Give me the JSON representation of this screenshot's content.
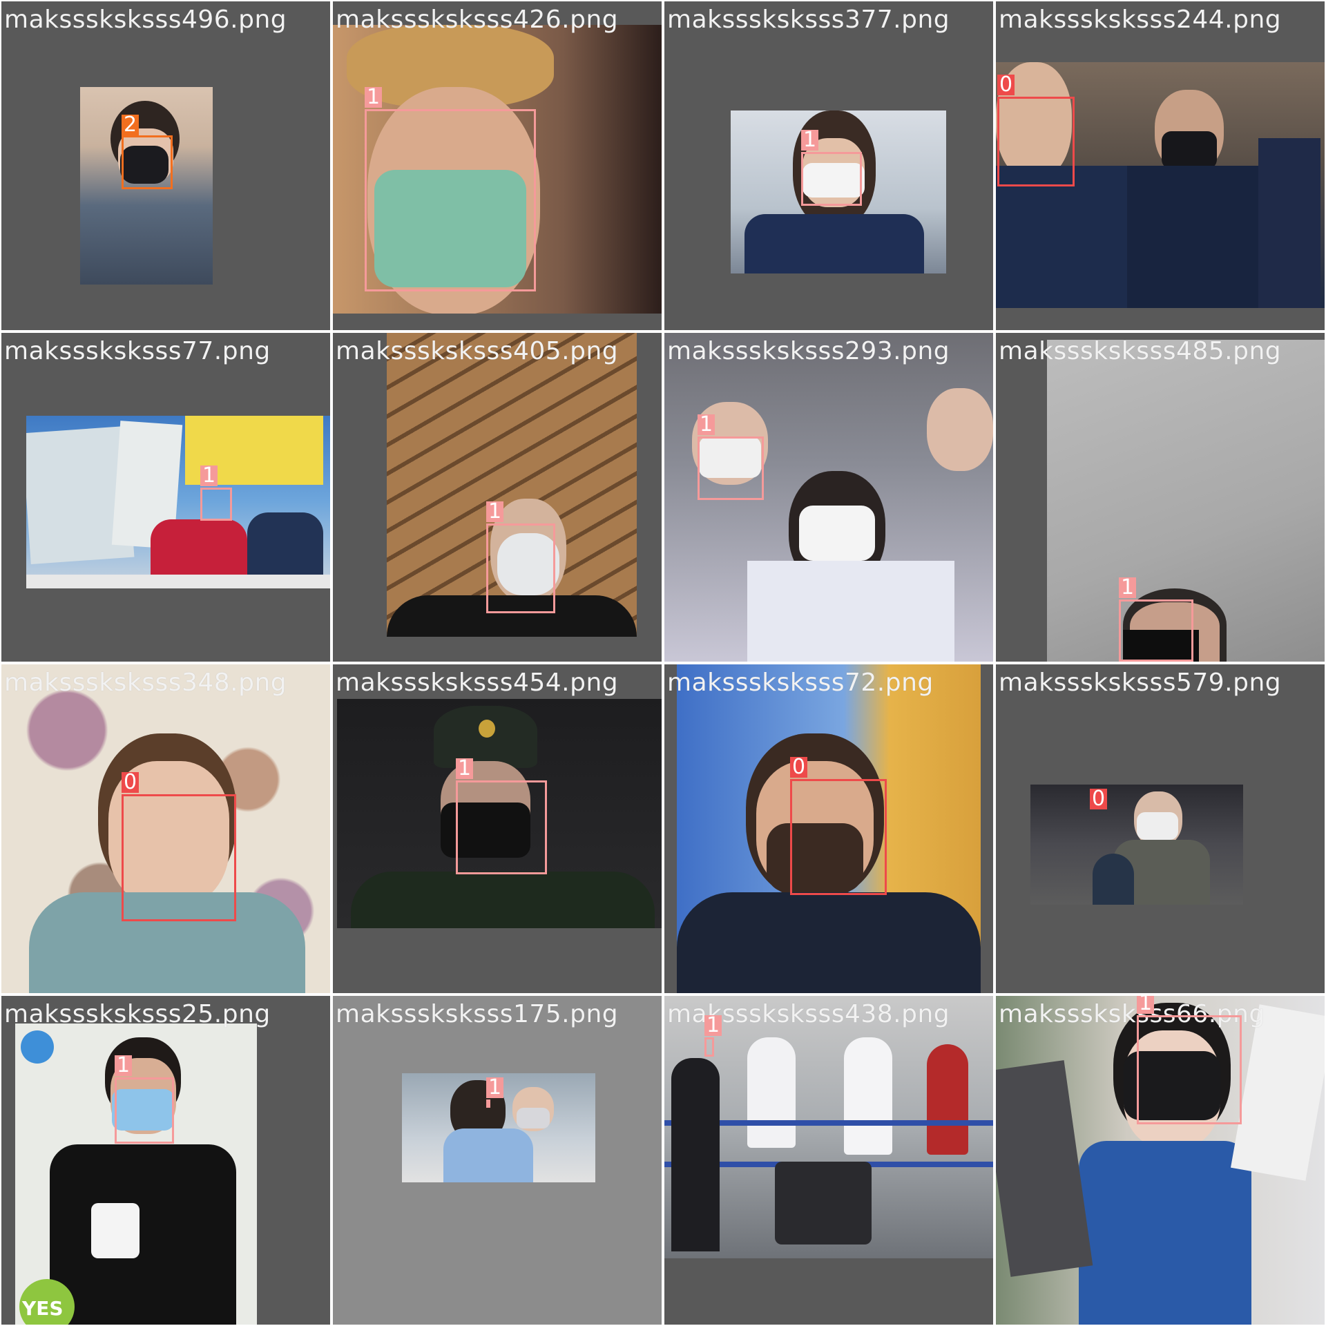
{
  "class_colors": {
    "0": "#ee4a4a",
    "1": "#f59a9a",
    "2": "#f26f1f"
  },
  "tiles": [
    {
      "file": "maksssksksss496.png",
      "labels": [
        "2"
      ]
    },
    {
      "file": "maksssksksss426.png",
      "labels": [
        "1"
      ]
    },
    {
      "file": "maksssksksss377.png",
      "labels": [
        "1"
      ]
    },
    {
      "file": "maksssksksss244.png",
      "labels": [
        "0"
      ]
    },
    {
      "file": "maksssksksss77.png",
      "labels": [
        "1"
      ]
    },
    {
      "file": "maksssksksss405.png",
      "labels": [
        "1"
      ]
    },
    {
      "file": "maksssksksss293.png",
      "labels": [
        "1"
      ]
    },
    {
      "file": "maksssksksss485.png",
      "labels": [
        "1"
      ]
    },
    {
      "file": "maksssksksss348.png",
      "labels": [
        "0"
      ]
    },
    {
      "file": "maksssksksss454.png",
      "labels": [
        "1"
      ]
    },
    {
      "file": "maksssksksss72.png",
      "labels": [
        "0"
      ]
    },
    {
      "file": "maksssksksss579.png",
      "labels": [
        "0"
      ]
    },
    {
      "file": "maksssksksss25.png",
      "labels": [
        "1"
      ]
    },
    {
      "file": "maksssksksss175.png",
      "labels": [
        "1"
      ]
    },
    {
      "file": "maksssksksss438.png",
      "labels": [
        "1"
      ]
    },
    {
      "file": "maksssksksss66.png",
      "labels": [
        "1"
      ]
    }
  ],
  "photo_text": {
    "tile13_badge": "YES"
  }
}
